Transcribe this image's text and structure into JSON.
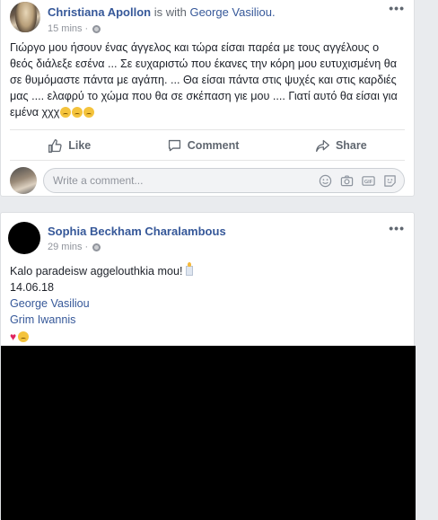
{
  "post1": {
    "author": "Christiana Apollon",
    "with_text": "is with",
    "tagged": "George Vasiliou.",
    "time": "15 mins",
    "body": "Γιώργο μου ήσουν ένας άγγελος και τώρα είσαι παρέα με τους αγγέλους ο θεός διάλεξε εσένα ... Σε ευχαριστώ που έκανες την κόρη μου ευτυχισμένη θα σε θυμόμαστε πάντα με αγάπη. ... Θα είσαι πάντα στις ψυχές και στις καρδιές μας .... ελαφρύ το χώμα που θα σε σκέπαση γιε μου .... Γιατί αυτό θα είσαι για εμένα χχχ",
    "more": "•••",
    "actions": {
      "like": "Like",
      "comment": "Comment",
      "share": "Share"
    },
    "comment_placeholder": "Write a comment...",
    "icons": [
      "emoji-icon",
      "camera-icon",
      "gif-icon",
      "sticker-icon"
    ]
  },
  "post2": {
    "author": "Sophia Beckham Charalambous",
    "time": "29 mins",
    "more": "•••",
    "line1": "Kalo paradeisw aggelouthkia mou!",
    "date": "14.06.18",
    "tag1": "George Vasiliou",
    "tag2": "Grim Iwannis"
  },
  "colors": {
    "link": "#365899",
    "background": "#e9ebee",
    "muted": "#90949c"
  }
}
